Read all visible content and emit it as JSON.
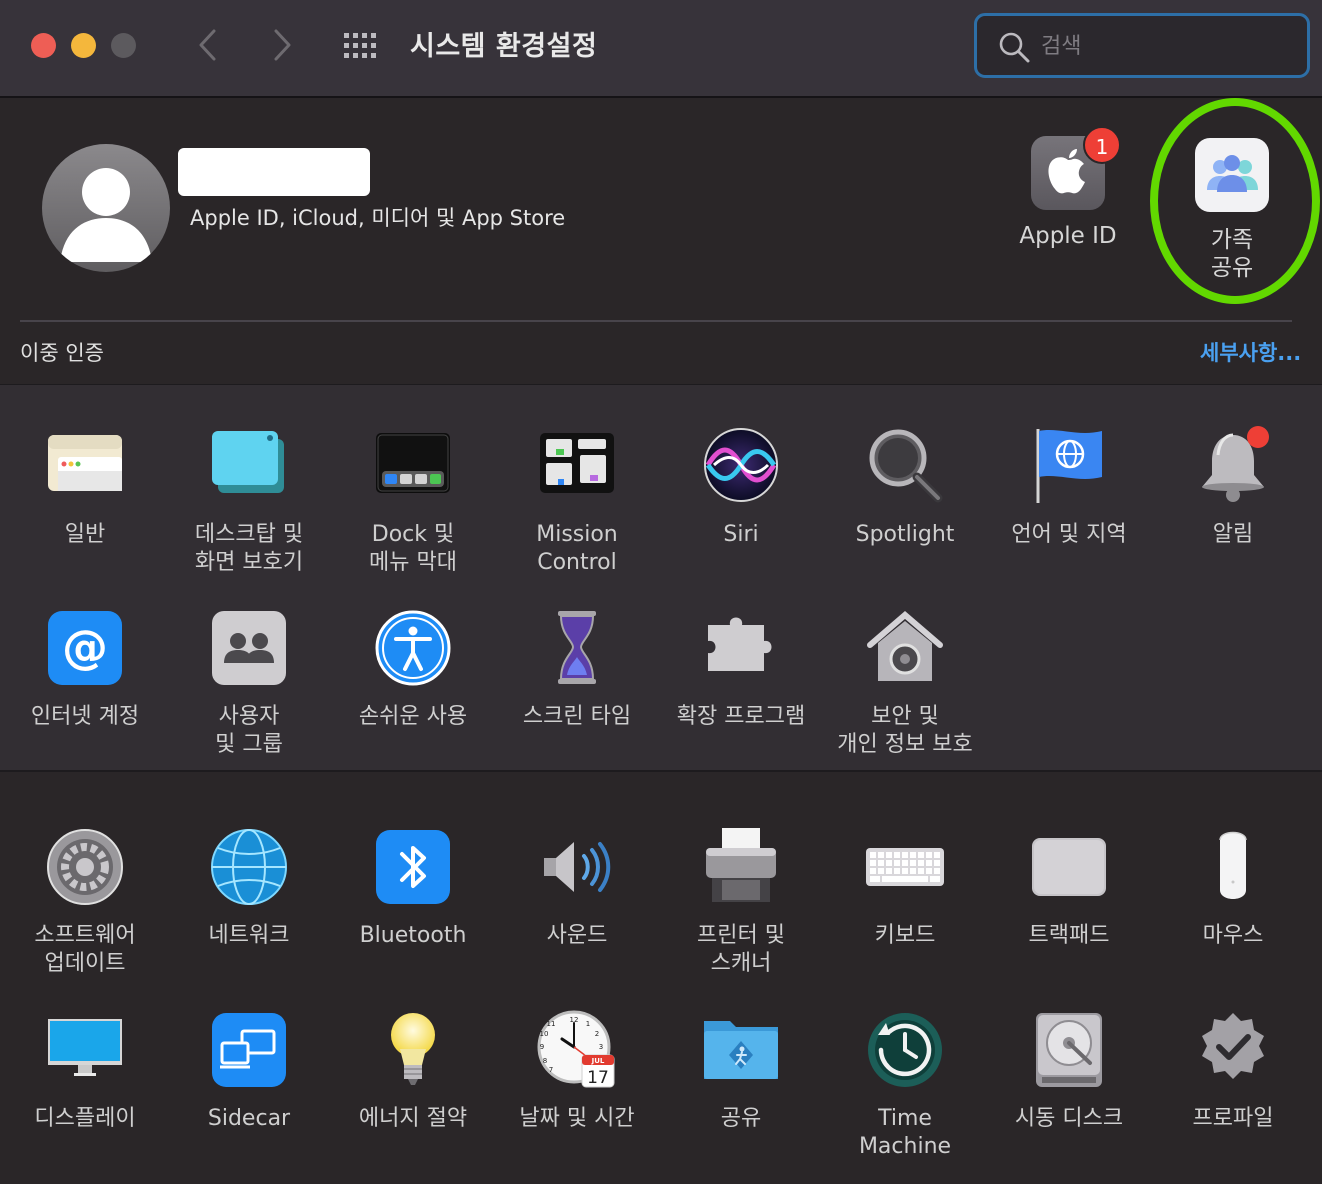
{
  "window": {
    "title": "시스템 환경설정",
    "search_placeholder": "검색"
  },
  "account": {
    "subtitle": "Apple ID, iCloud, 미디어 및 App Store",
    "two_factor_label": "이중 인증",
    "details_link": "세부사항...",
    "tiles": {
      "apple_id": {
        "label": "Apple ID",
        "badge": "1"
      },
      "family": {
        "label": "가족\n공유"
      }
    }
  },
  "section_a": [
    {
      "label": "일반",
      "icon": "general-icon"
    },
    {
      "label": "데스크탑 및\n화면 보호기",
      "icon": "desktop-screensaver-icon"
    },
    {
      "label": "Dock 및\n메뉴 막대",
      "icon": "dock-icon"
    },
    {
      "label": "Mission\nControl",
      "icon": "mission-control-icon"
    },
    {
      "label": "Siri",
      "icon": "siri-icon"
    },
    {
      "label": "Spotlight",
      "icon": "spotlight-icon"
    },
    {
      "label": "언어 및 지역",
      "icon": "language-region-icon"
    },
    {
      "label": "알림",
      "icon": "notifications-icon"
    },
    {
      "label": "인터넷 계정",
      "icon": "internet-accounts-icon"
    },
    {
      "label": "사용자\n및 그룹",
      "icon": "users-groups-icon"
    },
    {
      "label": "손쉬운 사용",
      "icon": "accessibility-icon"
    },
    {
      "label": "스크린 타임",
      "icon": "screen-time-icon"
    },
    {
      "label": "확장 프로그램",
      "icon": "extensions-icon"
    },
    {
      "label": "보안 및\n개인 정보 보호",
      "icon": "security-privacy-icon"
    }
  ],
  "section_b": [
    {
      "label": "소프트웨어\n업데이트",
      "icon": "software-update-icon"
    },
    {
      "label": "네트워크",
      "icon": "network-icon"
    },
    {
      "label": "Bluetooth",
      "icon": "bluetooth-icon"
    },
    {
      "label": "사운드",
      "icon": "sound-icon"
    },
    {
      "label": "프린터 및\n스캐너",
      "icon": "printers-scanners-icon"
    },
    {
      "label": "키보드",
      "icon": "keyboard-icon"
    },
    {
      "label": "트랙패드",
      "icon": "trackpad-icon"
    },
    {
      "label": "마우스",
      "icon": "mouse-icon"
    },
    {
      "label": "디스플레이",
      "icon": "displays-icon"
    },
    {
      "label": "Sidecar",
      "icon": "sidecar-icon"
    },
    {
      "label": "에너지 절약",
      "icon": "energy-saver-icon"
    },
    {
      "label": "날짜 및 시간",
      "icon": "date-time-icon",
      "calendar_month": "JUL",
      "calendar_day": "17"
    },
    {
      "label": "공유",
      "icon": "sharing-icon"
    },
    {
      "label": "Time\nMachine",
      "icon": "time-machine-icon"
    },
    {
      "label": "시동 디스크",
      "icon": "startup-disk-icon"
    },
    {
      "label": "프로파일",
      "icon": "profiles-icon"
    }
  ],
  "colors": {
    "accent_link": "#4aa0f0",
    "highlight_ring": "#62d800",
    "badge": "#ee3f36"
  }
}
